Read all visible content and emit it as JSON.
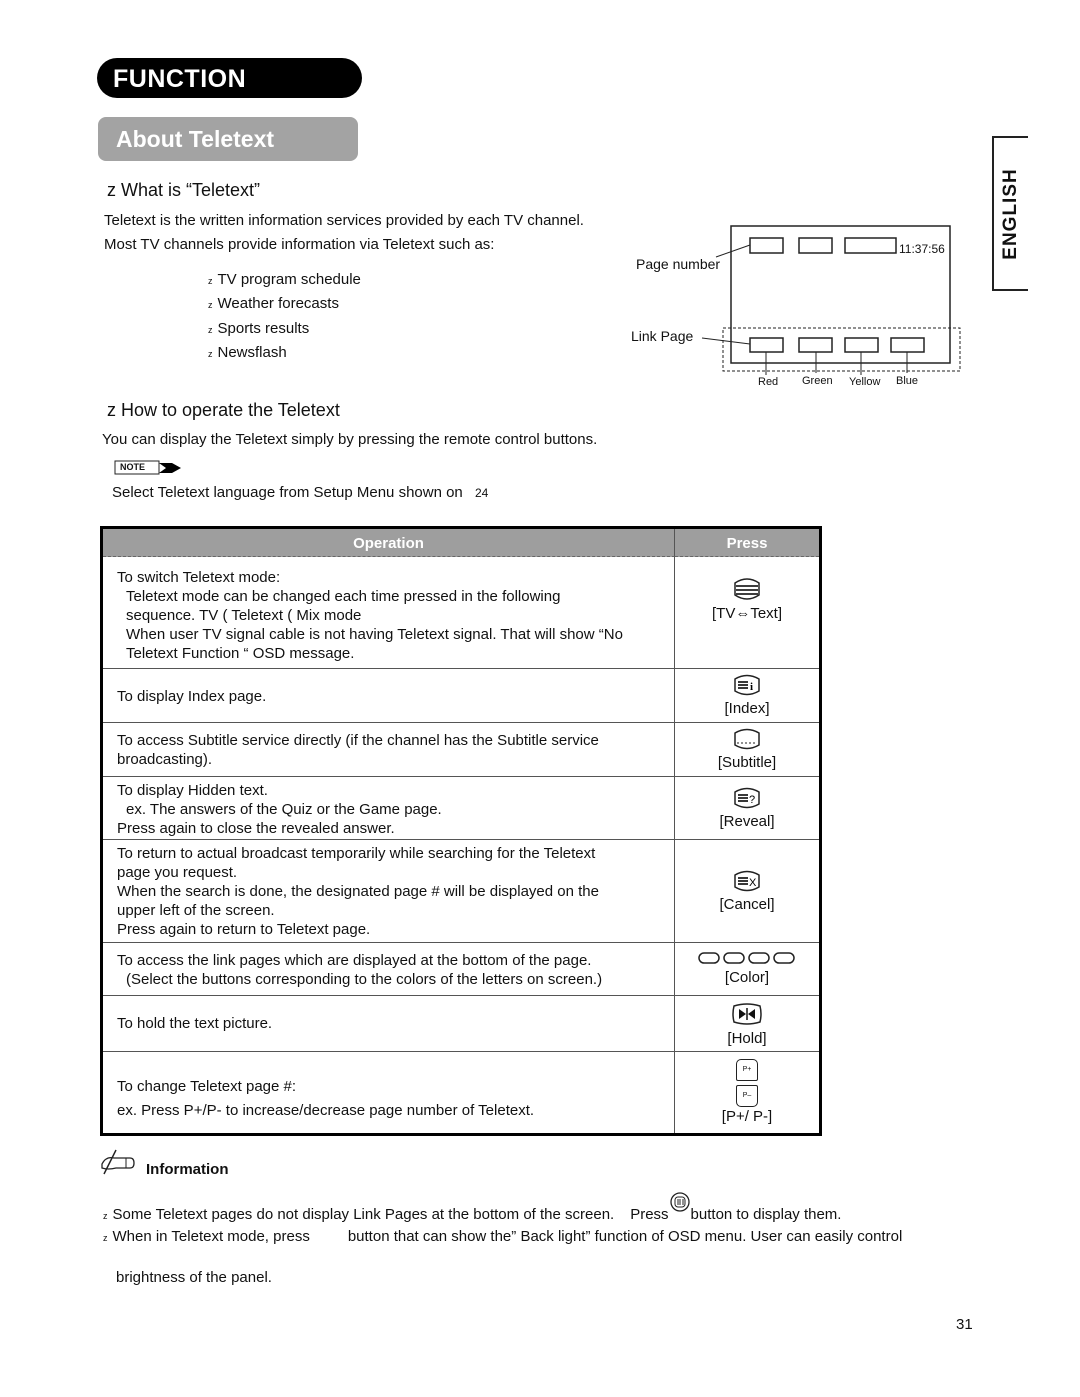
{
  "header": {
    "section_banner": "FUNCTION",
    "subsection_banner": "About Teletext",
    "language_tab": "ENGLISH"
  },
  "what_is": {
    "bullet": "z",
    "heading": "What is “Teletext”",
    "para1": "Teletext is the written information services provided by each TV channel.",
    "para2": "Most TV channels provide information via Teletext such as:",
    "items": [
      "TV program schedule",
      "Weather forecasts",
      "Sports results",
      "Newsflash"
    ]
  },
  "diagram": {
    "page_number_label": "Page number",
    "link_page_label": "Link Page",
    "clock": "11:37:56",
    "link_colors": [
      "Red",
      "Green",
      "Yellow",
      "Blue"
    ]
  },
  "how_to": {
    "bullet": "z",
    "heading": "How to operate the Teletext",
    "intro": "You can display the Teletext simply by pressing the remote control buttons.",
    "note_badge": "NOTE",
    "note_text": "Select Teletext language from Setup Menu shown on",
    "note_page": "24"
  },
  "table": {
    "col_operation": "Operation",
    "col_press": "Press",
    "rows": [
      {
        "lines": [
          "To switch Teletext mode:",
          "Teletext mode can be changed each time pressed in the following",
          "sequence. TV (  Teletext (  Mix mode",
          "When user TV signal cable is not having Teletext signal. That will show “No",
          "Teletext Function “ OSD message."
        ],
        "icon": "text-mode-icon",
        "key": "[TV⇔Text]"
      },
      {
        "lines": [
          "To display Index page."
        ],
        "icon": "index-icon",
        "key": "[Index]"
      },
      {
        "lines": [
          "To access Subtitle service directly (if the channel has the Subtitle service",
          "broadcasting)."
        ],
        "icon": "subtitle-icon",
        "key": "[Subtitle]"
      },
      {
        "lines": [
          "To display Hidden text.",
          "ex. The answers of the Quiz or the Game page.",
          "Press again to close the revealed answer."
        ],
        "icon": "reveal-icon",
        "key": "[Reveal]"
      },
      {
        "lines": [
          "To return to actual broadcast temporarily while searching for the Teletext",
          "page you request.",
          "When the search is done, the designated page # will be displayed on the",
          "upper left of the screen.",
          "Press again to return to Teletext page."
        ],
        "icon": "cancel-icon",
        "key": "[Cancel]"
      },
      {
        "lines": [
          "To access the link pages which are displayed at the bottom of the page.",
          "(Select the buttons corresponding to the colors of the letters on screen.)"
        ],
        "icon": "color-buttons-icon",
        "key": "[Color]"
      },
      {
        "lines": [
          "To hold the text picture."
        ],
        "icon": "hold-icon",
        "key": "[Hold]"
      },
      {
        "lines": [
          "To change Teletext page #:",
          "ex. Press P+/P- to increase/decrease page number of Teletext."
        ],
        "icon": "page-up-down-icon",
        "key": "[P+/ P-]",
        "p_plus": "P+",
        "p_minus": "P–"
      }
    ]
  },
  "information": {
    "title": "Information",
    "bullet": "z",
    "line1_a": "Some Teletext pages do not display Link Pages at the bottom of the screen.",
    "line1_b": "Press",
    "line1_c": "button to display them.",
    "line2_a": "When in Teletext mode, press",
    "line2_b": "button that can show the” Back light” function of OSD menu. User can easily control",
    "line3": "brightness of the panel."
  },
  "footer": {
    "page_number": "31"
  }
}
